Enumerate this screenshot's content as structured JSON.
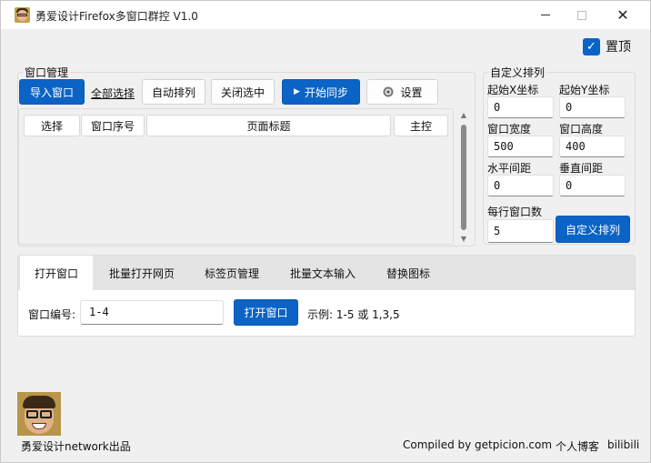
{
  "window": {
    "title": "勇爱设计Firefox多窗口群控 V1.0",
    "controls": {
      "minimize": "—",
      "maximize": "☐",
      "close": "✕"
    }
  },
  "pin": {
    "label": "置顶",
    "checked": true
  },
  "window_manage": {
    "group_label": "窗口管理",
    "buttons": {
      "import": "导入窗口",
      "select_all": "全部选择",
      "auto_arrange": "自动排列",
      "close_selected": "关闭选中",
      "start_sync": "开始同步",
      "settings": "设置"
    },
    "icons": {
      "play": "play-icon",
      "settings": "gear-icon"
    },
    "table": {
      "columns": [
        "选择",
        "窗口序号",
        "页面标题",
        "主控"
      ],
      "rows": []
    }
  },
  "custom_layout": {
    "group_label": "自定义排列",
    "fields": {
      "start_x": {
        "label": "起始X坐标",
        "value": "0"
      },
      "start_y": {
        "label": "起始Y坐标",
        "value": "0"
      },
      "width": {
        "label": "窗口宽度",
        "value": "500"
      },
      "height": {
        "label": "窗口高度",
        "value": "400"
      },
      "h_gap": {
        "label": "水平间距",
        "value": "0"
      },
      "v_gap": {
        "label": "垂直间距",
        "value": "0"
      },
      "per_row": {
        "label": "每行窗口数",
        "value": "5"
      }
    },
    "apply_button": "自定义排列"
  },
  "tabs": {
    "items": [
      "打开窗口",
      "批量打开网页",
      "标签页管理",
      "批量文本输入",
      "替换图标"
    ],
    "active_index": 0,
    "open_window": {
      "field_label": "窗口编号:",
      "field_value": "1-4",
      "button": "打开窗口",
      "hint": "示例: 1-5 或 1,3,5"
    }
  },
  "footer": {
    "brand": "勇爱设计network出品",
    "compiled_by": "Compiled by getpicion.com",
    "blog": "个人博客",
    "bilibili": "bilibili"
  },
  "colors": {
    "primary": "#0b63c5",
    "window_bg": "#f0f0f0",
    "titlebar_bg": "#ffffff",
    "tabbar_bg": "#e4e4e4"
  }
}
